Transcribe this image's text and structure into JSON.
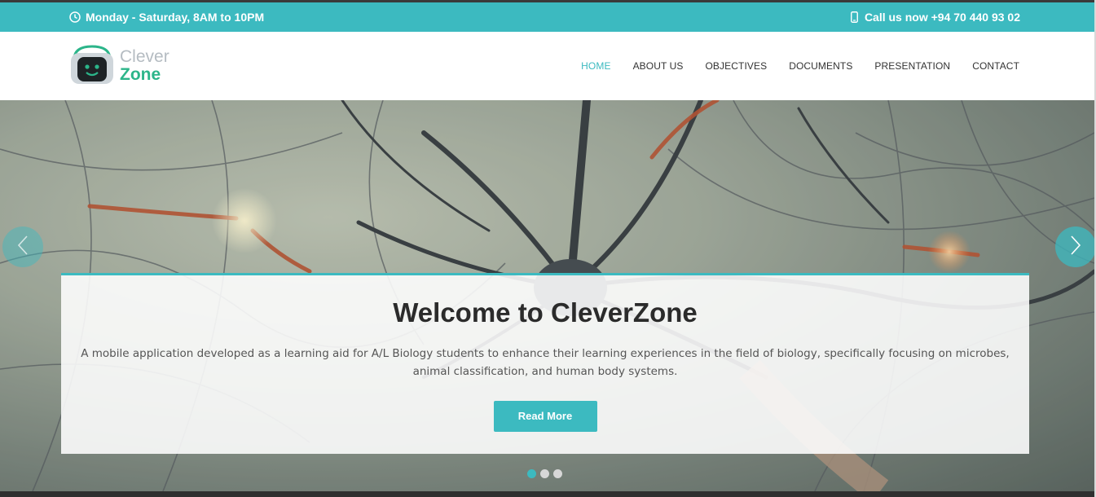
{
  "topbar": {
    "hours": "Monday - Saturday, 8AM to 10PM",
    "phone": "Call us now +94 70 440 93 02",
    "accent": "#3cbac0",
    "icons": [
      "clock-icon",
      "phone-icon"
    ]
  },
  "brand": {
    "line1": "Clever",
    "line2": "Zone",
    "line1_color": "#b5bcc2",
    "line2_color": "#2cb58a"
  },
  "nav": {
    "items": [
      {
        "label": "HOME",
        "active": true
      },
      {
        "label": "ABOUT US",
        "active": false
      },
      {
        "label": "OBJECTIVES",
        "active": false
      },
      {
        "label": "DOCUMENTS",
        "active": false
      },
      {
        "label": "PRESENTATION",
        "active": false
      },
      {
        "label": "CONTACT",
        "active": false
      }
    ]
  },
  "hero": {
    "title": "Welcome to CleverZone",
    "description": "A mobile application developed as a learning aid for A/L Biology students to enhance their learning experiences in the field of biology, specifically focusing on microbes, animal classification, and human body systems.",
    "button_label": "Read More",
    "slides_count": 3,
    "active_slide": 1
  }
}
